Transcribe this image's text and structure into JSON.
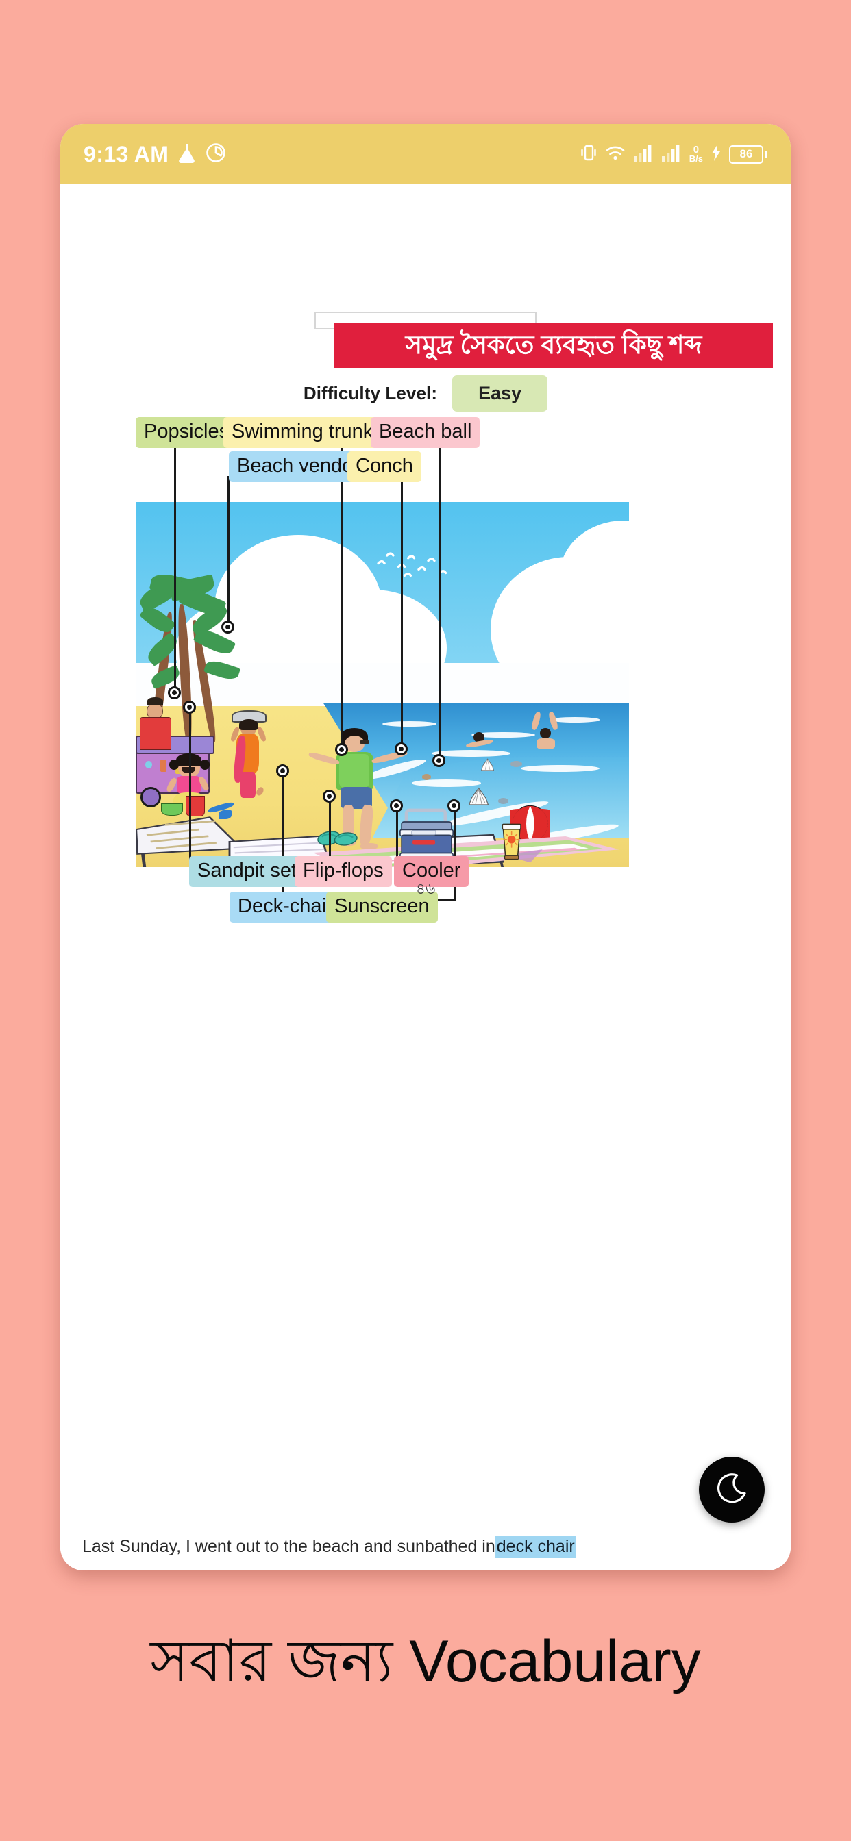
{
  "colors": {
    "page_background": "#fbab9d",
    "statusbar": "#edcf6b",
    "title_banner": "#e01f3d",
    "difficulty_pill": "#d8e8b4",
    "chip_green": "#cfe398",
    "chip_yellow": "#fbf0ad",
    "chip_pink": "#fbc7ce",
    "chip_pink_dark": "#f69aa8",
    "chip_blue": "#a9dbf5",
    "chip_blue_light": "#aedde4",
    "highlight": "#9fd6f2",
    "fab": "#050505"
  },
  "statusbar": {
    "time": "9:13 AM",
    "left_icons": [
      "flask-icon",
      "shutter-icon"
    ],
    "right_icons": [
      "vibrate-icon",
      "wifi-icon",
      "signal-bars-icon",
      "signal-bars-2-icon"
    ],
    "net_speed_value": "0",
    "net_speed_unit": "B/s",
    "battery_level": "86",
    "charging_icon": "charging-bolt-icon"
  },
  "document": {
    "title": "সমুদ্র সৈকতে ব্যবহৃত কিছু শব্দ",
    "difficulty_label": "Difficulty Level:",
    "difficulty_value": "Easy",
    "page_number": "৪৬"
  },
  "labels": [
    {
      "id": "popsicles",
      "text": "Popsicles",
      "color": "chip_green"
    },
    {
      "id": "swimming-trunks",
      "text": "Swimming trunks",
      "color": "chip_yellow"
    },
    {
      "id": "beach-ball",
      "text": "Beach ball",
      "color": "chip_pink"
    },
    {
      "id": "beach-vendor",
      "text": "Beach vendor",
      "color": "chip_blue"
    },
    {
      "id": "conch",
      "text": "Conch",
      "color": "chip_yellow"
    },
    {
      "id": "sandpit-set",
      "text": "Sandpit set",
      "color": "chip_blue_light"
    },
    {
      "id": "flip-flops",
      "text": "Flip-flops",
      "color": "chip_pink"
    },
    {
      "id": "cooler",
      "text": "Cooler",
      "color": "chip_pink_dark"
    },
    {
      "id": "deck-chair",
      "text": "Deck-chair",
      "color": "chip_blue"
    },
    {
      "id": "sunscreen",
      "text": "Sunscreen",
      "color": "chip_green"
    }
  ],
  "sentence": {
    "prefix": "Last Sunday, I went out to the beach and sunbathed in ",
    "highlighted": "deck chair"
  },
  "fab": {
    "icon": "moon-icon"
  },
  "caption": {
    "text": "সবার জন্য Vocabulary"
  }
}
